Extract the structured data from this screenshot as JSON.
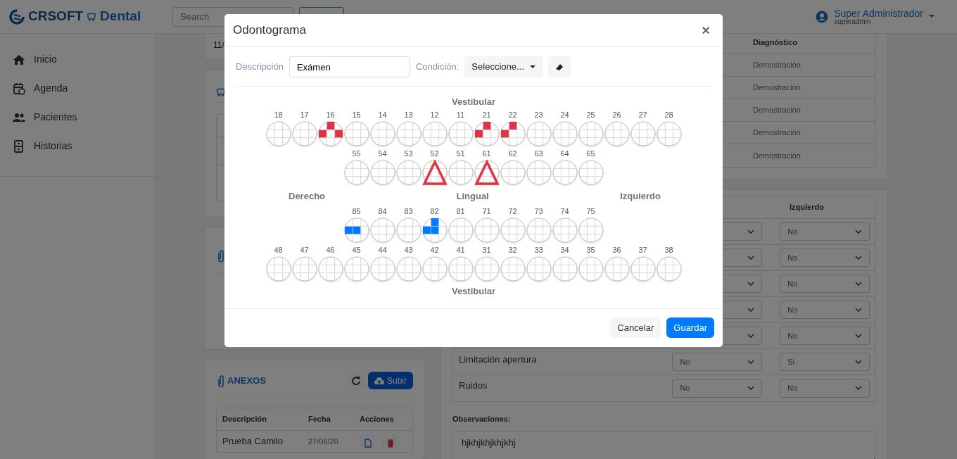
{
  "navbar": {
    "brand": "CRSOFT",
    "brand_suffix": "Dental",
    "search": {
      "placeholder": "Search"
    },
    "user": {
      "name": "Super Administrador",
      "username": "superadmin"
    }
  },
  "sidebar": {
    "items": [
      {
        "label": "Inicio"
      },
      {
        "label": "Agenda"
      },
      {
        "label": "Pacientes"
      },
      {
        "label": "Historias"
      }
    ]
  },
  "left_panel": {
    "date_fragment": "11/",
    "anexos": {
      "title": "ANEXOS",
      "upload_button": "Subir",
      "columns": [
        "Descripción",
        "Fecha",
        "Acciones"
      ],
      "rows": [
        {
          "description": "Prueba Camilo",
          "date": "27/06/20"
        }
      ]
    }
  },
  "right_panel": {
    "diagnosis_table": {
      "column": "Diagnóstico",
      "rows": [
        "Demostración",
        "Demostración",
        "Demostración",
        "Demostración",
        "Demostración"
      ]
    },
    "exam_table": {
      "column": "Izquierdo",
      "rows": [
        {
          "izquierdo": "No"
        },
        {
          "izquierdo": "No"
        },
        {
          "izquierdo": "No"
        },
        {
          "izquierdo": "No"
        },
        {
          "izquierdo": "No"
        },
        {
          "label": "Limitación apertura",
          "derecho": "No",
          "izquierdo": "Si"
        },
        {
          "label": "Ruidos",
          "derecho": "No",
          "izquierdo": "No"
        }
      ]
    },
    "observations": {
      "label": "Observaciones:",
      "value": "hjkhjkhjkhjkhj"
    }
  },
  "modal": {
    "title": "Odontograma",
    "close": "×",
    "description_label": "Descripción",
    "description_value": "Exámen",
    "condition_label": "Condición:",
    "condition_dropdown": "Seleccione...",
    "top_label": "Vestibular",
    "side_labels": [
      "Derecho",
      "Lingual",
      "Izquierdo"
    ],
    "bottom_label": "Vestibular",
    "teeth_rows": [
      [
        {
          "number": "18"
        },
        {
          "number": "17"
        },
        {
          "number": "16",
          "surfaces": [
            {
              "kind": "top",
              "color": "#dc3545"
            },
            {
              "kind": "left",
              "color": "#dc3545"
            },
            {
              "kind": "right",
              "color": "#dc3545"
            }
          ]
        },
        {
          "number": "15"
        },
        {
          "number": "14"
        },
        {
          "number": "13"
        },
        {
          "number": "12"
        },
        {
          "number": "11"
        },
        {
          "number": "21",
          "surfaces": [
            {
              "kind": "top",
              "color": "#dc3545"
            },
            {
              "kind": "left",
              "color": "#dc3545"
            }
          ]
        },
        {
          "number": "22",
          "surfaces": [
            {
              "kind": "top",
              "color": "#dc3545"
            },
            {
              "kind": "left",
              "color": "#dc3545"
            }
          ]
        },
        {
          "number": "23"
        },
        {
          "number": "24"
        },
        {
          "number": "25"
        },
        {
          "number": "26"
        },
        {
          "number": "27"
        },
        {
          "number": "28"
        }
      ],
      [
        {
          "number": "55"
        },
        {
          "number": "54"
        },
        {
          "number": "53"
        },
        {
          "number": "52",
          "triangle": {
            "color": "#dc3545"
          }
        },
        {
          "number": "51"
        },
        {
          "number": "61",
          "triangle": {
            "color": "#dc3545"
          }
        },
        {
          "number": "62"
        },
        {
          "number": "63"
        },
        {
          "number": "64"
        },
        {
          "number": "65"
        }
      ],
      [
        {
          "number": "85",
          "surfaces": [
            {
              "kind": "left",
              "color": "#007bff"
            },
            {
              "kind": "center",
              "color": "#007bff"
            }
          ]
        },
        {
          "number": "84"
        },
        {
          "number": "83"
        },
        {
          "number": "82",
          "surfaces": [
            {
              "kind": "top",
              "color": "#007bff"
            },
            {
              "kind": "left",
              "color": "#007bff"
            },
            {
              "kind": "center",
              "color": "#007bff"
            }
          ]
        },
        {
          "number": "81"
        },
        {
          "number": "71"
        },
        {
          "number": "72"
        },
        {
          "number": "73"
        },
        {
          "number": "74"
        },
        {
          "number": "75"
        }
      ],
      [
        {
          "number": "48"
        },
        {
          "number": "47"
        },
        {
          "number": "46"
        },
        {
          "number": "45"
        },
        {
          "number": "44"
        },
        {
          "number": "43"
        },
        {
          "number": "42"
        },
        {
          "number": "41"
        },
        {
          "number": "31"
        },
        {
          "number": "32"
        },
        {
          "number": "33"
        },
        {
          "number": "34"
        },
        {
          "number": "35"
        },
        {
          "number": "36"
        },
        {
          "number": "37"
        },
        {
          "number": "38"
        }
      ]
    ],
    "buttons": [
      {
        "label": "Cancelar",
        "kind": "secondary"
      },
      {
        "label": "Guardar",
        "kind": "primary"
      }
    ]
  }
}
